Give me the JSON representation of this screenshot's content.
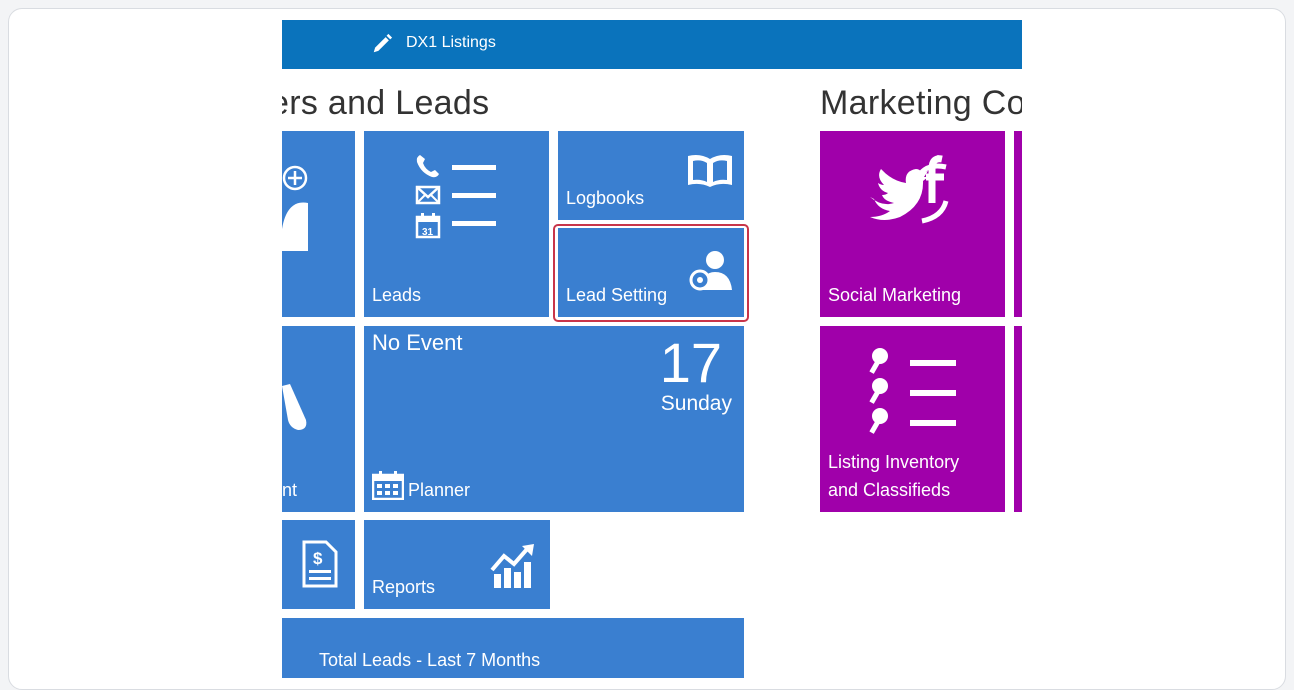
{
  "header": {
    "title": "DX1 Listings",
    "icon": "pencil-icon"
  },
  "sections": {
    "customers_title": "ers and Leads",
    "marketing_title": "Marketing Co"
  },
  "tiles": {
    "leads": {
      "label": "Leads"
    },
    "logbooks": {
      "label": "Logbooks"
    },
    "lead_setting": {
      "label": "Lead Setting"
    },
    "planner": {
      "event": "No Event",
      "date": "17",
      "day": "Sunday",
      "label": "Planner"
    },
    "appointment_partial": {
      "label": "nt"
    },
    "reports": {
      "label": "Reports"
    },
    "total_leads": {
      "label": "Total Leads - Last 7 Months"
    },
    "social_marketing": {
      "label": "Social Marketing"
    },
    "listing_inventory": {
      "label_line1": "Listing Inventory",
      "label_line2": "and Classifieds"
    }
  },
  "colors": {
    "header_blue": "#0a73bc",
    "tile_blue": "#3a7fd0",
    "tile_magenta": "#a000aa",
    "highlight": "#c8354a"
  }
}
